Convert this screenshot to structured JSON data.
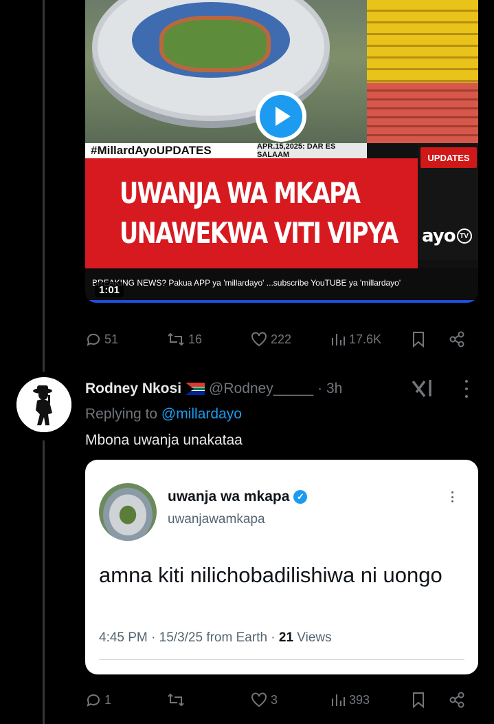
{
  "video": {
    "hashtag": "#MillardAyoUPDATES",
    "date_line": "APR.15,2025: DAR ES SALAAM",
    "updates_label": "UPDATES",
    "headline_line1": "UWANJA WA MKAPA",
    "headline_line2": "UNAWEKWA VITI VIPYA",
    "logo_text": "ayo",
    "logo_tv": "TV",
    "ticker": "BREAKING NEWS? Pakua APP ya 'millardayo' ...subscribe YouTUBE ya 'millardayo'",
    "duration": "1:01"
  },
  "post_actions": {
    "replies": "51",
    "reposts": "16",
    "likes": "222",
    "views": "17.6K"
  },
  "reply": {
    "name": "Rodney Nkosi",
    "handle": "@Rodney_____",
    "time": "· 3h",
    "replying_prefix": "Replying to ",
    "replying_to": "@millardayo",
    "text": "Mbona uwanja unakataa"
  },
  "quoted_card": {
    "name": "uwanja wa mkapa",
    "handle": "uwanjawamkapa",
    "text": "amna kiti nilichobadilishiwa ni uongo",
    "meta": "4:45 PM · 15/3/25 from Earth · ",
    "views_count": "21",
    "views_label": " Views"
  },
  "reply_actions": {
    "replies": "1",
    "reposts": "",
    "likes": "3",
    "views": "393"
  },
  "colors": {
    "background": "#000000",
    "text_primary": "#e7e9ea",
    "text_secondary": "#71767b",
    "accent": "#1d9bf0",
    "headline_red": "#d71920"
  }
}
